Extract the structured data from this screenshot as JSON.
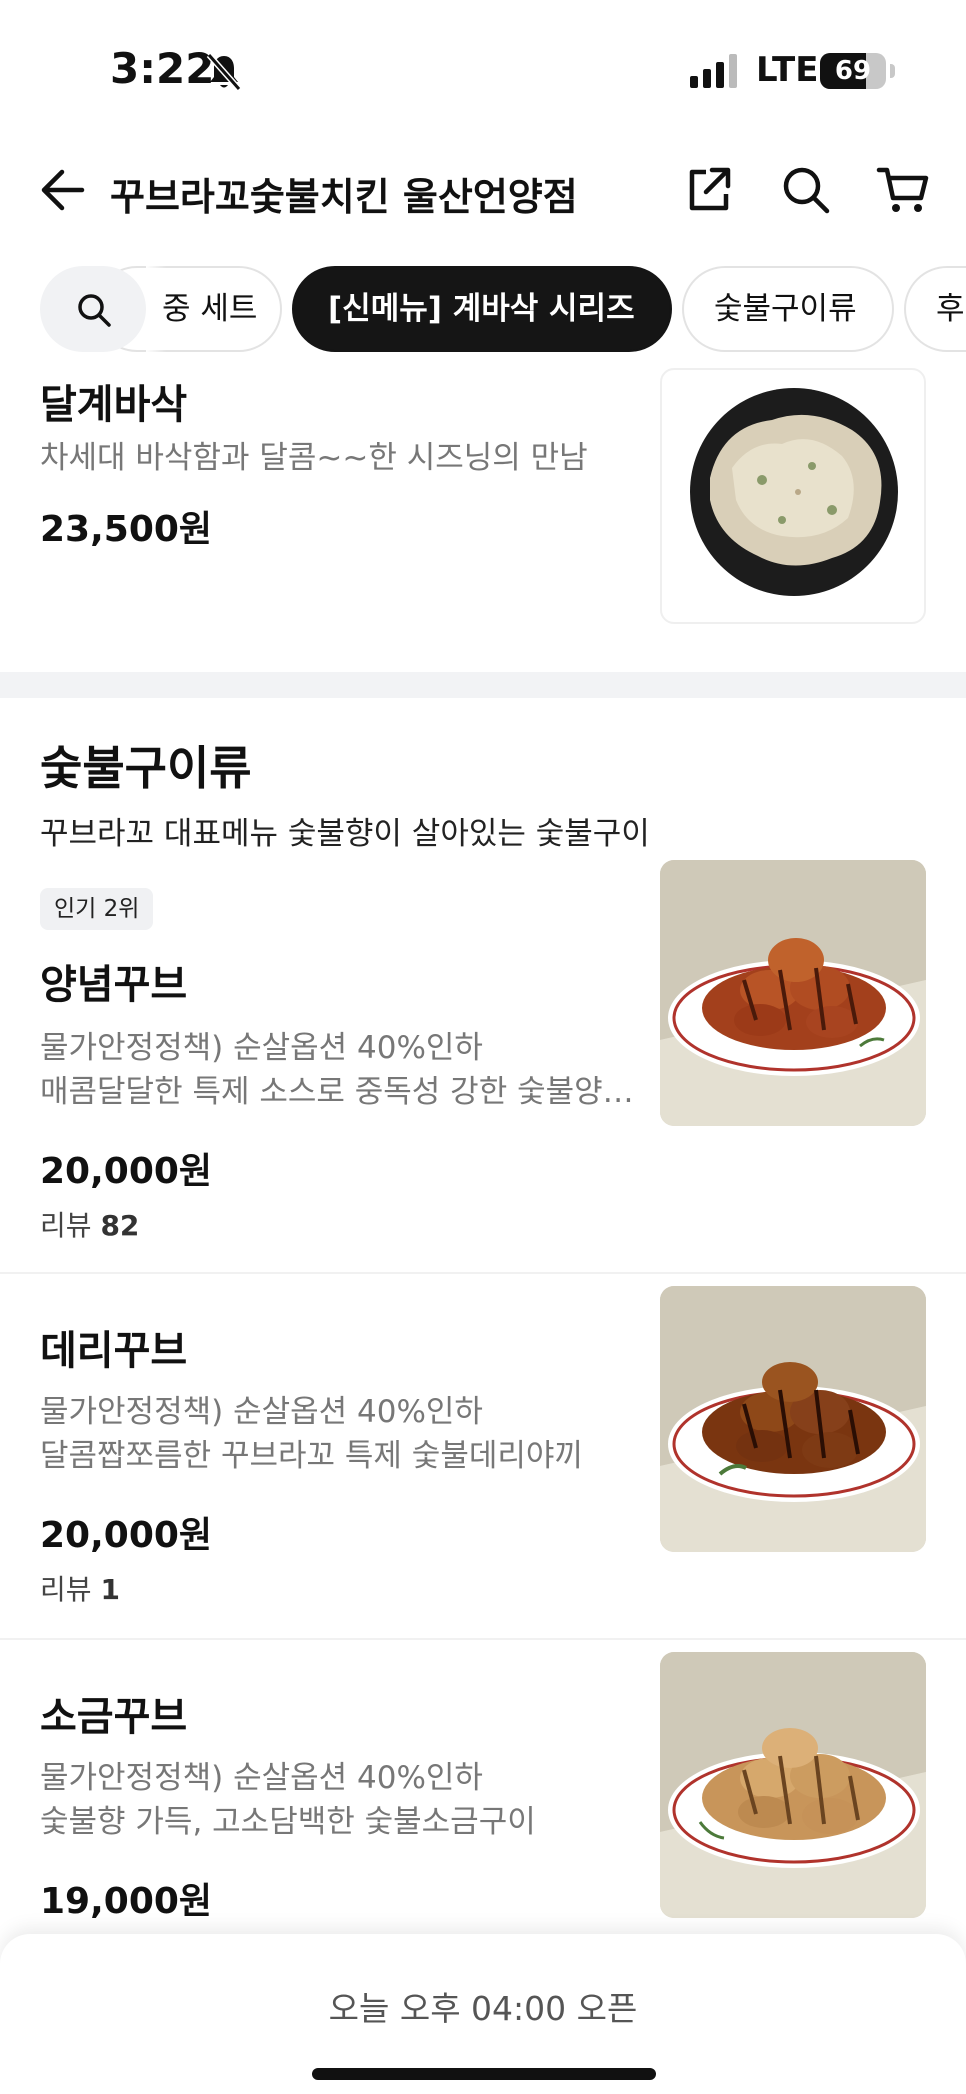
{
  "status_bar": {
    "time": "3:22",
    "network": "LTE",
    "battery": "69",
    "battery_level": 0.69
  },
  "header": {
    "title": "꾸브라꼬숯불치킨 울산언양점",
    "icons": [
      "back-arrow-icon",
      "share-icon",
      "search-icon",
      "cart-icon"
    ]
  },
  "tabs": [
    {
      "label": "중 세트",
      "active": false
    },
    {
      "label": "[신메뉴] 계바삭 시리즈",
      "active": true
    },
    {
      "label": "숯불구이류",
      "active": false
    },
    {
      "label": "후",
      "active": false
    }
  ],
  "prev_item": {
    "name": "달계바삭",
    "desc": "차세대 바삭함과 달콤~~한 시즈닝의 만남",
    "price": "23,500원"
  },
  "section": {
    "title": "숯불구이류",
    "desc": "꾸브라꼬 대표메뉴 숯불향이 살아있는 숯불구이"
  },
  "items": [
    {
      "badge": "인기 2위",
      "name": "양념꾸브",
      "desc1": "물가안정정책) 순살옵션 40%인하",
      "desc2": "매콤달달한 특제 소스로 중독성 강한 숯불양…",
      "price": "20,000원",
      "review_label": "리뷰",
      "review_count": "82"
    },
    {
      "name": "데리꾸브",
      "desc1": "물가안정정책) 순살옵션 40%인하",
      "desc2": "달콤짭쪼름한 꾸브라꼬 특제 숯불데리야끼",
      "price": "20,000원",
      "review_label": "리뷰",
      "review_count": "1"
    },
    {
      "name": "소금꾸브",
      "desc1": "물가안정정책) 순살옵션 40%인하",
      "desc2": "숯불향 가득, 고소담백한 숯불소금구이",
      "price": "19,000원"
    }
  ],
  "bottom_bar": {
    "open_text": "오늘 오후 04:00 오픈"
  }
}
